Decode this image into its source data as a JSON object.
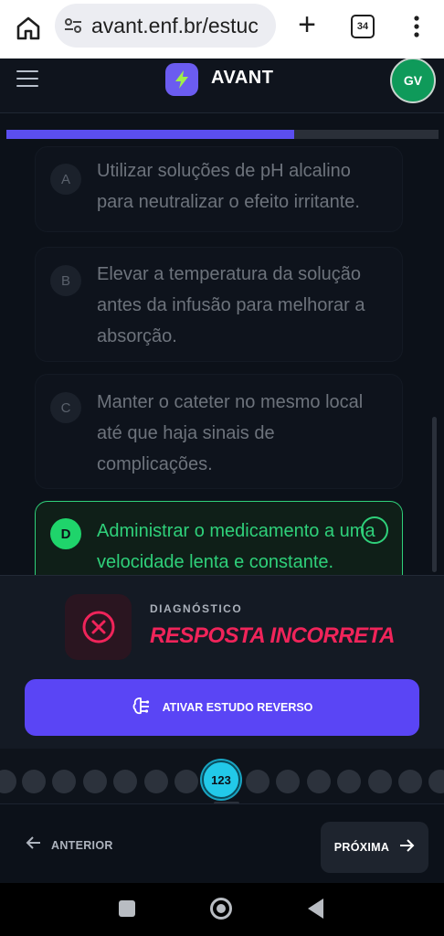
{
  "browser": {
    "url": "avant.enf.br/estuc",
    "tab_count": "34",
    "icons": {
      "home": "home-icon",
      "site_settings": "tune-icon",
      "new_tab": "plus-icon",
      "tabs": "tabs-icon",
      "menu": "more-vert-icon"
    }
  },
  "header": {
    "brand": "AVANT",
    "avatar_initials": "GV",
    "colors": {
      "logo_bg": "#6b5cf0",
      "avatar_bg": "#0f9a5a"
    }
  },
  "progress": {
    "fraction": 0.667,
    "color": "#5b4ef0"
  },
  "options": [
    {
      "letter": "A",
      "text": "Utilizar soluções de pH alcalino para neutralizar o efeito irritante."
    },
    {
      "letter": "B",
      "text": "Elevar a temperatura da solução antes da infusão para melhorar a absorção."
    },
    {
      "letter": "C",
      "text": "Manter o cateter no mesmo local até que haja sinais de complicações."
    },
    {
      "letter": "D",
      "text": "Administrar o medicamento a uma velocidade lenta e constante.",
      "state": "correct"
    }
  ],
  "diagnostic": {
    "label": "DIAGNÓSTICO",
    "result": "RESPOSTA INCORRETA",
    "result_color": "#f0245a",
    "icon": "x-circle-icon"
  },
  "reverse_study": {
    "label": "ATIVAR ESTUDO REVERSO",
    "icon": "brain-icon",
    "color": "#5a45f5"
  },
  "navigator": {
    "current_question": "123",
    "current_color": "#22c9e9"
  },
  "footer": {
    "prev_label": "ANTERIOR",
    "next_label": "PRÓXIMA"
  }
}
